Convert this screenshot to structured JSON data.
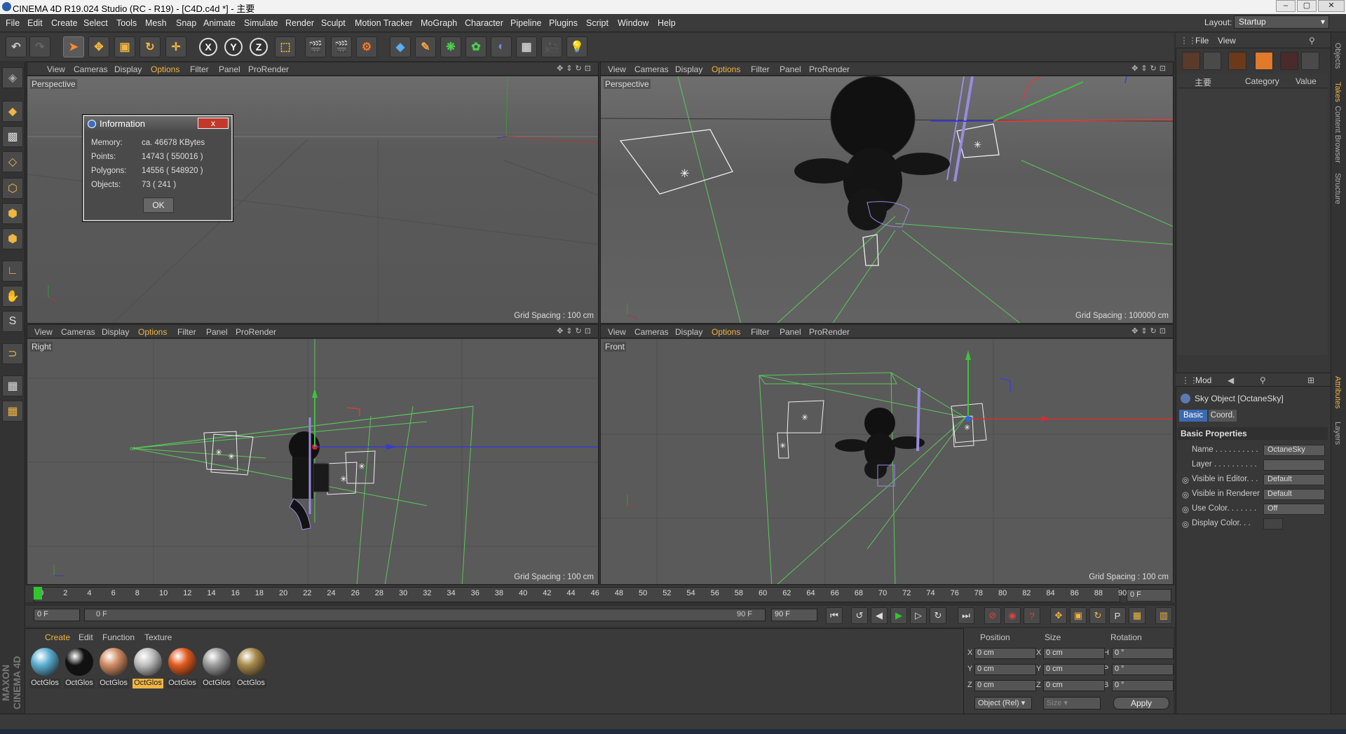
{
  "window": {
    "title": "CINEMA 4D R19.024 Studio (RC - R19) - [C4D.c4d *] - 主要"
  },
  "menu": [
    "File",
    "Edit",
    "Create",
    "Select",
    "Tools",
    "Mesh",
    "Snap",
    "Animate",
    "Simulate",
    "Render",
    "Sculpt",
    "Motion Tracker",
    "MoGraph",
    "Character",
    "Pipeline",
    "Plugins",
    "Script",
    "Window",
    "Help"
  ],
  "layout": {
    "label": "Layout:",
    "value": "Startup"
  },
  "viewport_menu": [
    "View",
    "Cameras",
    "Display",
    "Options",
    "Filter",
    "Panel",
    "ProRender"
  ],
  "viewports": [
    {
      "label": "Perspective",
      "grid": "Grid Spacing : 100 cm"
    },
    {
      "label": "Perspective",
      "grid": "Grid Spacing : 100000 cm"
    },
    {
      "label": "Right",
      "grid": "Grid Spacing : 100 cm"
    },
    {
      "label": "Front",
      "grid": "Grid Spacing : 100 cm"
    }
  ],
  "info_dialog": {
    "title": "Information",
    "close": "x",
    "rows": [
      {
        "k": "Memory:",
        "v": "ca. 46678 KBytes"
      },
      {
        "k": "Points:",
        "v": "14743 ( 550016 )"
      },
      {
        "k": "Polygons:",
        "v": "14556 ( 548920 )"
      },
      {
        "k": "Objects:",
        "v": "73 ( 241 )"
      }
    ],
    "ok": "OK"
  },
  "timeline": {
    "ticks": [
      "0",
      "2",
      "4",
      "6",
      "8",
      "10",
      "12",
      "14",
      "16",
      "18",
      "20",
      "22",
      "24",
      "26",
      "28",
      "30",
      "32",
      "34",
      "36",
      "38",
      "40",
      "42",
      "44",
      "46",
      "48",
      "50",
      "52",
      "54",
      "56",
      "58",
      "60",
      "62",
      "64",
      "66",
      "68",
      "70",
      "72",
      "74",
      "76",
      "78",
      "80",
      "82",
      "84",
      "86",
      "88",
      "90"
    ],
    "end_field": "0 F",
    "start": "0 F",
    "range_start": "0 F",
    "range_end": "90 F",
    "max": "90 F"
  },
  "material_menu": [
    "Create",
    "Edit",
    "Function",
    "Texture"
  ],
  "materials": [
    {
      "name": "OctGlos",
      "color": "#5aaed0"
    },
    {
      "name": "OctGlos",
      "color": "#111111"
    },
    {
      "name": "OctGlos",
      "color": "#d08a62"
    },
    {
      "name": "OctGlos",
      "color": "#bdbdbd",
      "selected": true
    },
    {
      "name": "OctGlos",
      "color": "#e05a1e"
    },
    {
      "name": "OctGlos",
      "color": "#9a9a9a"
    },
    {
      "name": "OctGlos",
      "color": "#a8894a"
    }
  ],
  "coords": {
    "headers": [
      "Position",
      "Size",
      "Rotation"
    ],
    "rows": [
      {
        "a": "X",
        "pos": "0 cm",
        "b": "X",
        "size": "0 cm",
        "c": "H",
        "rot": "0 °"
      },
      {
        "a": "Y",
        "pos": "0 cm",
        "b": "Y",
        "size": "0 cm",
        "c": "P",
        "rot": "0 °"
      },
      {
        "a": "Z",
        "pos": "0 cm",
        "b": "Z",
        "size": "0 cm",
        "c": "B",
        "rot": "0 °"
      }
    ],
    "mode": "Object (Rel)",
    "size_mode": "Size",
    "apply": "Apply"
  },
  "maxon": "MAXON CINEMA 4D",
  "objects_panel": {
    "menu": [
      "File",
      "View"
    ],
    "col1": "主要",
    "col2": "Category",
    "col3": "Value"
  },
  "attributes": {
    "mode": "Mod",
    "object": "Sky Object [OctaneSky]",
    "tabs": [
      "Basic",
      "Coord."
    ],
    "section": "Basic Properties",
    "props": [
      {
        "k": "Name . . . . . . . . . .",
        "v": "OctaneSky"
      },
      {
        "k": "Layer . . . . . . . . . .",
        "v": ""
      },
      {
        "k": "Visible in Editor. . .",
        "v": "Default"
      },
      {
        "k": "Visible in Renderer",
        "v": "Default"
      },
      {
        "k": "Use Color. . . . . . .",
        "v": "Off"
      },
      {
        "k": "Display Color. . .",
        "v": ""
      }
    ]
  },
  "side_tabs": [
    "Objects",
    "Takes",
    "Content Browser",
    "Structure",
    "Attributes",
    "Layers"
  ]
}
